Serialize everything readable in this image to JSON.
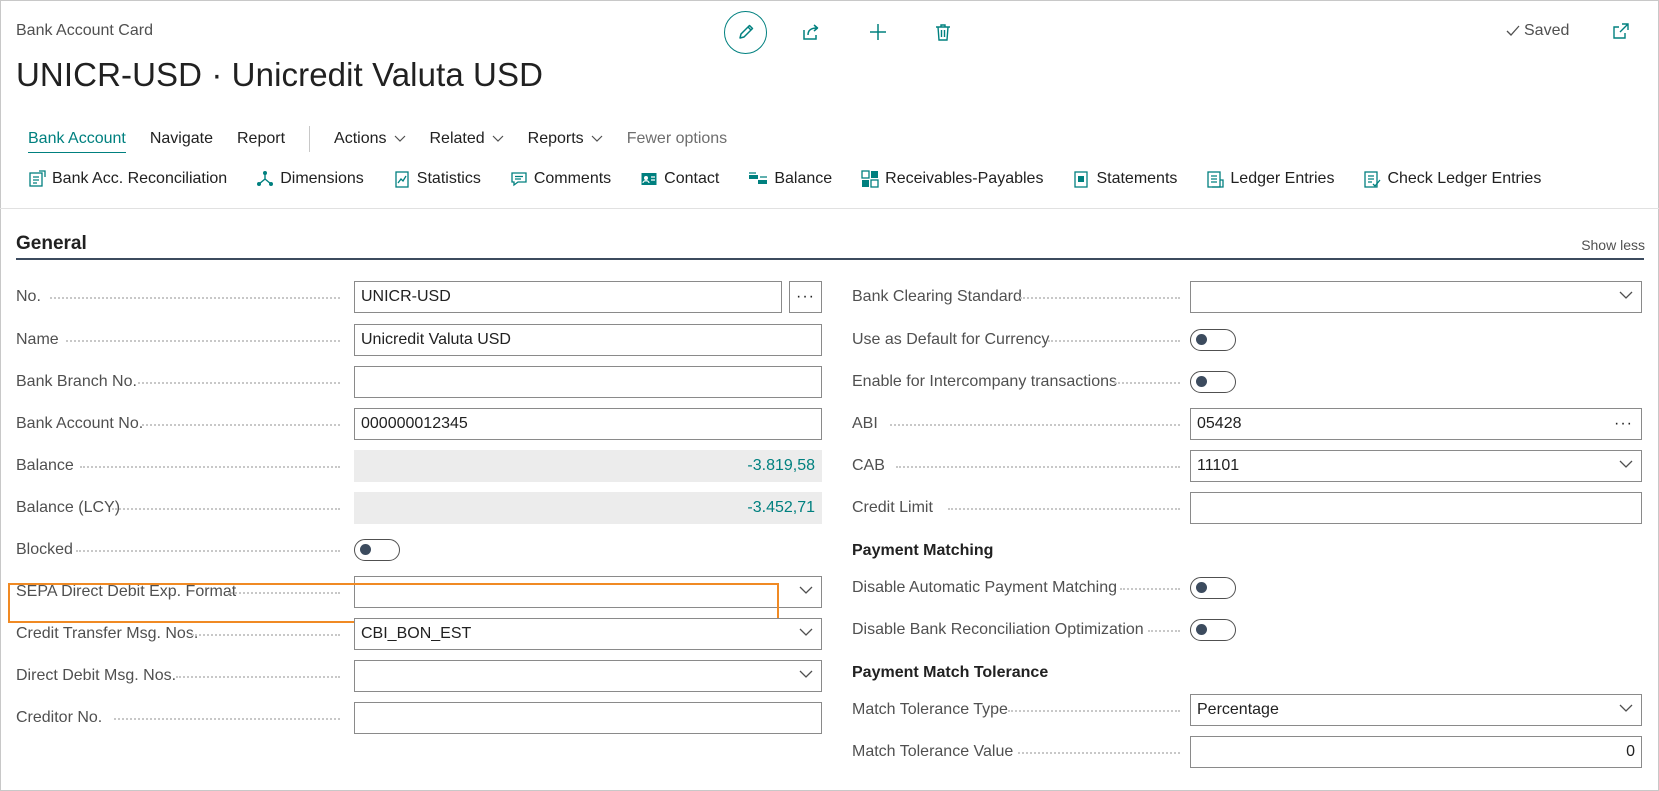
{
  "page": {
    "caption": "Bank Account Card",
    "title": "UNICR-USD · Unicredit Valuta USD",
    "saved_label": "Saved"
  },
  "toolbar_icons": [
    "edit-icon",
    "share-icon",
    "plus-icon",
    "delete-icon",
    "popout-icon"
  ],
  "tabs": {
    "bank_account": "Bank Account",
    "navigate": "Navigate",
    "report": "Report",
    "actions": "Actions",
    "related": "Related",
    "reports": "Reports",
    "fewer": "Fewer options"
  },
  "actions": [
    "Bank Acc. Reconciliation",
    "Dimensions",
    "Statistics",
    "Comments",
    "Contact",
    "Balance",
    "Receivables-Payables",
    "Statements",
    "Ledger Entries",
    "Check Ledger Entries"
  ],
  "section": {
    "title": "General",
    "show_less": "Show less"
  },
  "left_fields": {
    "no": {
      "label": "No.",
      "value": "UNICR-USD"
    },
    "name": {
      "label": "Name",
      "value": "Unicredit Valuta USD"
    },
    "branch": {
      "label": "Bank Branch No.",
      "value": ""
    },
    "account": {
      "label": "Bank Account No.",
      "value": "000000012345"
    },
    "balance": {
      "label": "Balance",
      "value": "-3.819,58"
    },
    "balance_lcy": {
      "label": "Balance (LCY)",
      "value": "-3.452,71"
    },
    "blocked": {
      "label": "Blocked",
      "on": false
    },
    "sepa": {
      "label": "SEPA Direct Debit Exp. Format",
      "value": ""
    },
    "credit_transfer": {
      "label": "Credit Transfer Msg. Nos.",
      "value": "CBI_BON_EST"
    },
    "direct_debit": {
      "label": "Direct Debit Msg. Nos.",
      "value": ""
    },
    "creditor": {
      "label": "Creditor No.",
      "value": ""
    }
  },
  "right_fields": {
    "clearing": {
      "label": "Bank Clearing Standard",
      "value": ""
    },
    "default_currency": {
      "label": "Use as Default for Currency",
      "on": false
    },
    "intercompany": {
      "label": "Enable for Intercompany transactions",
      "on": false
    },
    "abi": {
      "label": "ABI",
      "value": "05428"
    },
    "cab": {
      "label": "CAB",
      "value": "11101"
    },
    "credit_limit": {
      "label": "Credit Limit",
      "value": ""
    },
    "payment_matching_head": "Payment Matching",
    "disable_auto": {
      "label": "Disable Automatic Payment Matching",
      "on": false
    },
    "disable_recon": {
      "label": "Disable Bank Reconciliation Optimization",
      "on": false
    },
    "tolerance_head": "Payment Match Tolerance",
    "tol_type": {
      "label": "Match Tolerance Type",
      "value": "Percentage"
    },
    "tol_value": {
      "label": "Match Tolerance Value",
      "value": "0"
    }
  },
  "colors": {
    "accent": "#00807f",
    "highlight": "#f08a24"
  }
}
